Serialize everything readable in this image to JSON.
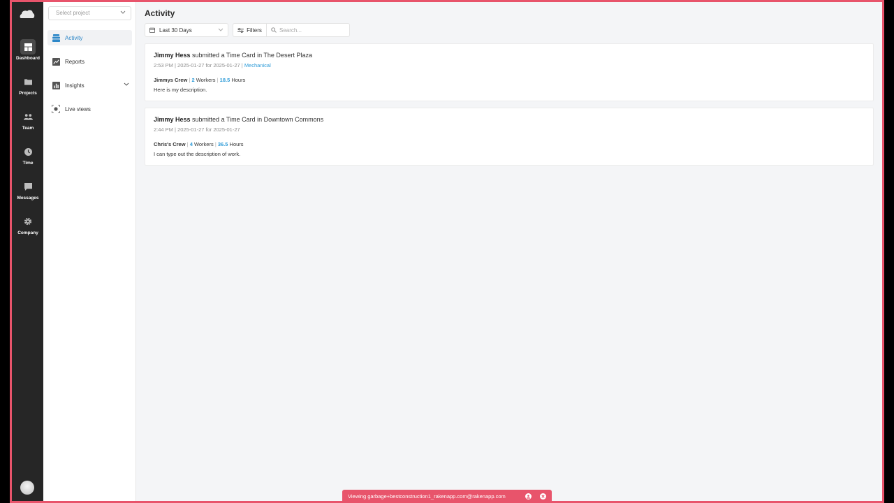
{
  "rail": {
    "items": [
      {
        "label": "Dashboard",
        "icon": "dashboard-icon"
      },
      {
        "label": "Projects",
        "icon": "folder-icon"
      },
      {
        "label": "Team",
        "icon": "team-icon"
      },
      {
        "label": "Time",
        "icon": "clock-icon"
      },
      {
        "label": "Messages",
        "icon": "message-icon"
      },
      {
        "label": "Company",
        "icon": "gear-icon"
      }
    ]
  },
  "sidebar": {
    "project_placeholder": "Select project",
    "items": [
      {
        "label": "Activity",
        "icon": "activity-icon"
      },
      {
        "label": "Reports",
        "icon": "chart-line-icon"
      },
      {
        "label": "Insights",
        "icon": "bar-chart-icon"
      },
      {
        "label": "Live views",
        "icon": "live-view-icon"
      }
    ]
  },
  "main": {
    "title": "Activity",
    "date_range": "Last 30 Days",
    "filters_label": "Filters",
    "search_placeholder": "Search..."
  },
  "activities": [
    {
      "user": "Jimmy Hess",
      "action": " submitted a Time Card in The Desert Plaza",
      "meta": "2:53 PM | 2025-01-27 for 2025-01-27 | ",
      "tag": "Mechanical",
      "crew": "Jimmys Crew",
      "workers": "2",
      "workers_label": " Workers ",
      "hours": "18.5",
      "hours_label": " Hours",
      "description": "Here is my description."
    },
    {
      "user": "Jimmy Hess",
      "action": " submitted a Time Card in Downtown Commons",
      "meta": "2:44 PM | 2025-01-27 for 2025-01-27",
      "crew": "Chris's Crew",
      "workers": "4",
      "workers_label": " Workers ",
      "hours": "36.5",
      "hours_label": " Hours",
      "description": "I can type out the description of work."
    }
  ],
  "banner": {
    "text": "Viewing garbage+bestconstruction1_rakenapp.com@rakenapp.com"
  },
  "colors": {
    "accent": "#2d9bd8",
    "banner": "#e8546b",
    "rail": "#262626"
  }
}
